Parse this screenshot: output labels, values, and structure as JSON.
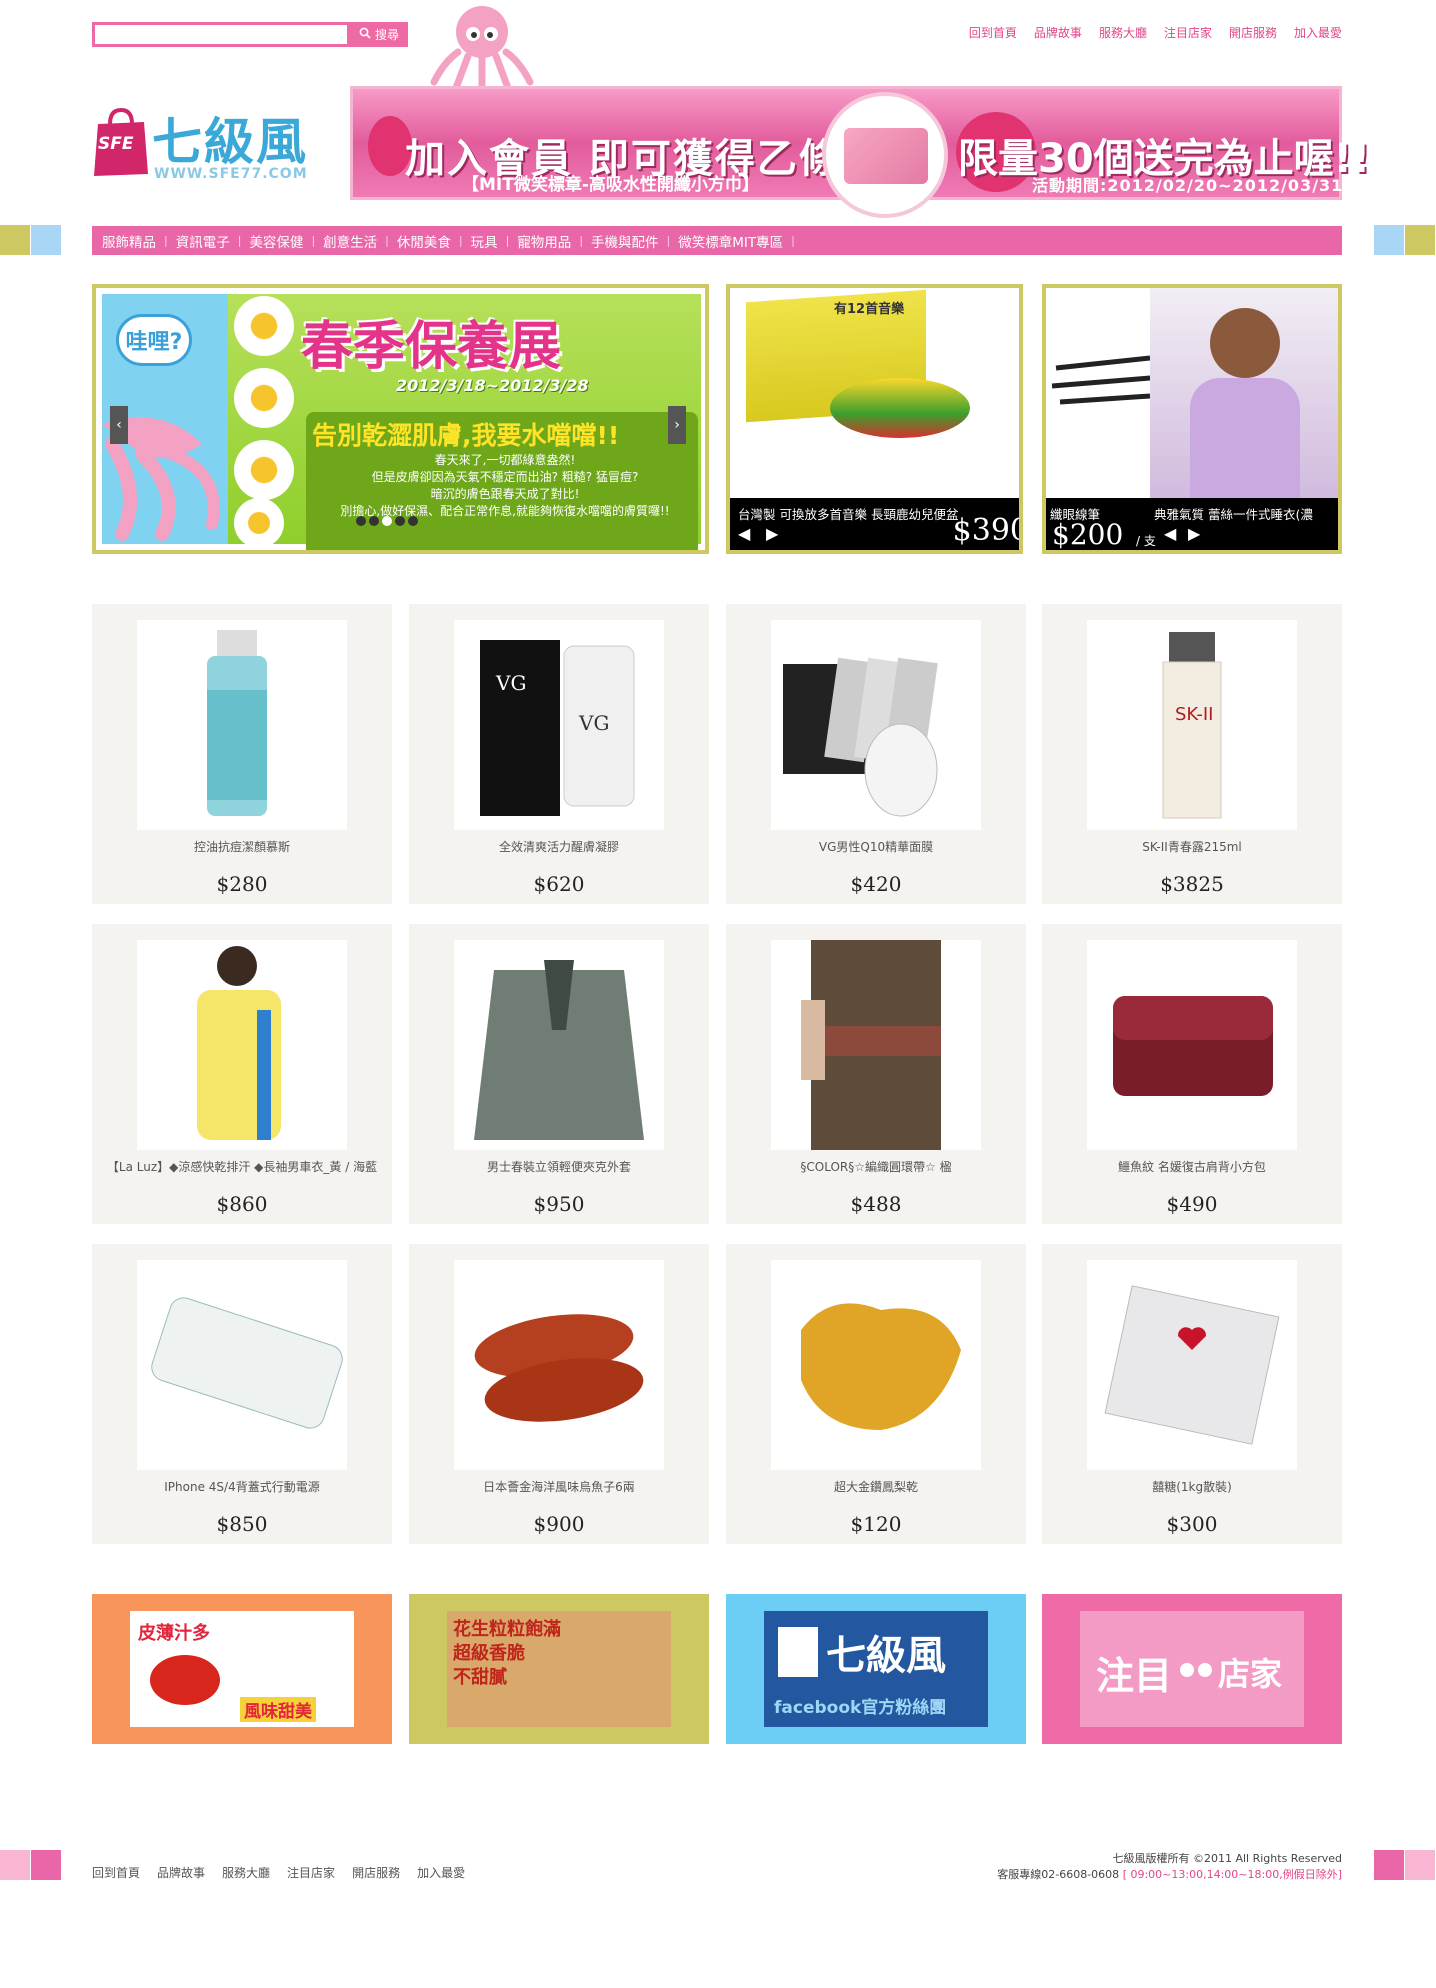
{
  "search": {
    "placeholder": "",
    "button_label": "搜尋"
  },
  "top_links": [
    "回到首頁",
    "品牌故事",
    "服務大廳",
    "注目店家",
    "開店服務",
    "加入最愛"
  ],
  "logo": {
    "name": "七級風",
    "abbr": "SFE",
    "url_text": "WWW.SFE77.COM"
  },
  "banner": {
    "headline": "加入會員 即可獲得乙條",
    "subline": "【MIT微笑標章-高吸水性開纖小方巾】",
    "limited": "限量30個送完為止喔!!",
    "period": "活動期間:2012/02/20~2012/03/31"
  },
  "nav": [
    "服飾精品",
    "資訊電子",
    "美容保健",
    "創意生活",
    "休閒美食",
    "玩具",
    "寵物用品",
    "手機與配件",
    "微笑標章MIT專區"
  ],
  "slider": {
    "bubble": "哇哩?",
    "title": "春季保養展",
    "dates": "2012/3/18~2012/3/28",
    "tagline": "告別乾澀肌膚,我要水噹噹!!",
    "body": [
      "春天來了,一切都綠意盎然!",
      "但是皮膚卻因為天氣不穩定而出油? 粗糙? 猛冒痘?",
      "暗沉的膚色跟春天成了對比!",
      "別擔心,做好保濕、配合正常作息,就能夠恢復水噹噹的膚質囉!!"
    ]
  },
  "feature2": {
    "badge": "有12首音樂",
    "caption": "台灣製 可換放多首音樂 長頸鹿幼兒便盆",
    "price": "$390"
  },
  "feature3": {
    "caption_left": "纖眼線筆",
    "caption_right": "典雅氣質 蕾絲一件式睡衣(濃",
    "price": "$200",
    "unit": "/ 支"
  },
  "products": [
    {
      "name": "控油抗痘潔顏慕斯",
      "price": "$280"
    },
    {
      "name": "全效清爽活力醒膚凝膠",
      "price": "$620"
    },
    {
      "name": "VG男性Q10精華面膜",
      "price": "$420"
    },
    {
      "name": "SK-II青春露215ml",
      "price": "$3825"
    },
    {
      "name": "【La Luz】◆涼感快乾排汗 ◆長袖男車衣_黃 / 海藍",
      "price": "$860"
    },
    {
      "name": "男士春裝立領輕便夾克外套",
      "price": "$950"
    },
    {
      "name": "§COLOR§☆編織圓環帶☆ 楹",
      "price": "$488"
    },
    {
      "name": "鱷魚紋 名媛復古肩背小方包",
      "price": "$490"
    },
    {
      "name": "IPhone 4S/4背蓋式行動電源",
      "price": "$850"
    },
    {
      "name": "日本薈金海洋風味烏魚子6兩",
      "price": "$900"
    },
    {
      "name": "超大金鑽鳳梨乾",
      "price": "$120"
    },
    {
      "name": "囍糖(1kg散裝)",
      "price": "$300"
    }
  ],
  "promos": [
    {
      "line1": "皮薄汁多",
      "line2": "風味甜美",
      "color": "#f8955a"
    },
    {
      "line1": "花生粒粒飽滿",
      "line2": "超級香脆",
      "line3": "不甜膩",
      "color": "#cdc861"
    },
    {
      "line1": "七級風",
      "line2": "facebook官方粉絲團",
      "color": "#6ccef5"
    },
    {
      "line1": "注目",
      "line2": "店家",
      "color": "#f06aa8"
    }
  ],
  "footer": {
    "links": [
      "回到首頁",
      "品牌故事",
      "服務大廳",
      "注目店家",
      "開店服務",
      "加入最愛"
    ],
    "copyright": "七級風版權所有 ©2011 All Rights Reserved",
    "hotline": "客服專線02-6608-0608",
    "hours": "[ 09:00~13:00,14:00~18:00,例假日除外]"
  },
  "colors": {
    "pink": "#e966a8",
    "olive": "#cdc861",
    "orange": "#f8955a",
    "sky": "#6ccef5",
    "card_bg": "#f4f3ef"
  }
}
